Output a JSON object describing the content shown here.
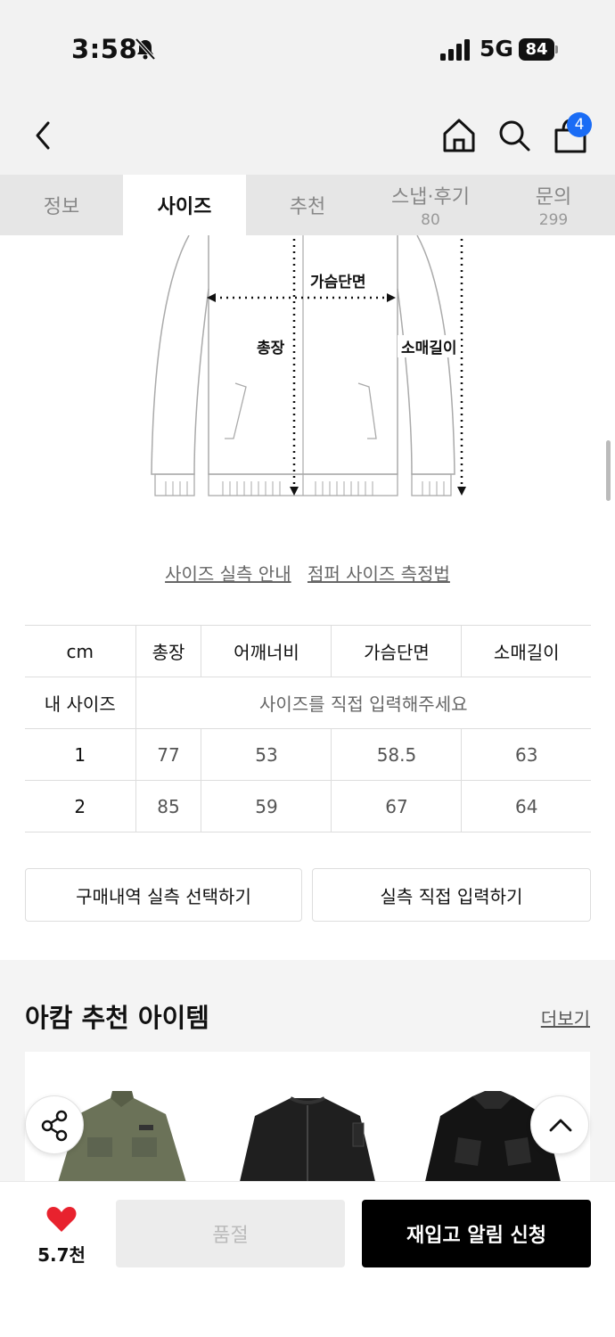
{
  "status_bar": {
    "time": "3:58",
    "network": "5G",
    "battery": "84"
  },
  "header": {
    "cart_count": "4"
  },
  "tabs": [
    {
      "label": "정보",
      "count": ""
    },
    {
      "label": "사이즈",
      "count": ""
    },
    {
      "label": "추천",
      "count": ""
    },
    {
      "label": "스냅·후기",
      "count": "80"
    },
    {
      "label": "문의",
      "count": "299"
    }
  ],
  "diagram": {
    "chest_label": "가슴단면",
    "length_label": "총장",
    "sleeve_label": "소매길이"
  },
  "guides": {
    "size_guide": "사이즈 실측 안내",
    "measure_guide": "점퍼 사이즈 측정법"
  },
  "size_table": {
    "headers": [
      "cm",
      "총장",
      "어깨너비",
      "가슴단면",
      "소매길이"
    ],
    "my_size_label": "내 사이즈",
    "my_size_prompt": "사이즈를 직접 입력해주세요",
    "rows": [
      {
        "size": "1",
        "values": [
          "77",
          "53",
          "58.5",
          "63"
        ]
      },
      {
        "size": "2",
        "values": [
          "85",
          "59",
          "67",
          "64"
        ]
      }
    ]
  },
  "actions": {
    "purchase_history": "구매내역 실측 선택하기",
    "direct_input": "실측 직접 입력하기"
  },
  "recommend": {
    "title": "아캄 추천 아이템",
    "more": "더보기"
  },
  "bottom_bar": {
    "likes": "5.7천",
    "soldout": "품절",
    "restock": "재입고 알림 신청"
  },
  "colors": {
    "accent_blue": "#1a6cf5",
    "like_red": "#e8222e"
  }
}
